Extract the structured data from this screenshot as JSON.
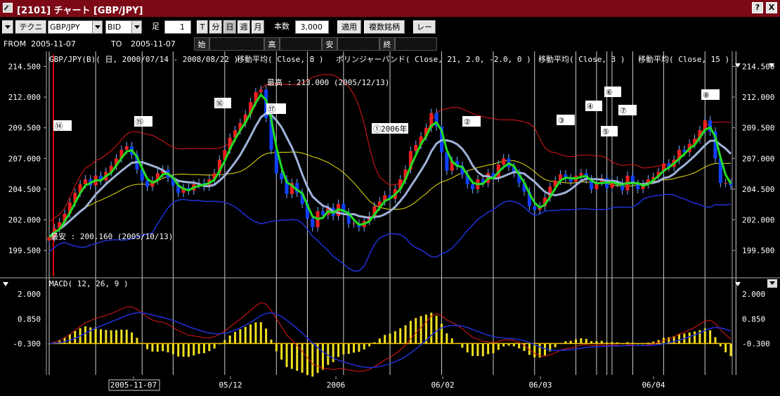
{
  "window": {
    "title": "[2101] チャート [GBP/JPY]",
    "btn_help": "?",
    "btn_close": "X"
  },
  "toolbar": {
    "technical": "テクニカル",
    "symbol": "GBP/JPY",
    "side": "BID",
    "ashi_label": "足",
    "ashi_value": "1",
    "t": "T",
    "fun": "分",
    "nichi": "日",
    "shu": "週",
    "tsuki": "月",
    "count_label": "本数",
    "count_value": "3,000",
    "apply": "適用",
    "multi": "複数銘柄",
    "rate": "レート"
  },
  "range": {
    "from_label": "FROM",
    "from_value": "2005-11-07",
    "to_label": "TO",
    "to_value": "2005-11-07",
    "open_label": "始",
    "high_label": "高",
    "low_label": "安",
    "close_label": "終"
  },
  "chart_data": {
    "type": "candlestick",
    "header": "GBP/JPY(B)( 日, 2000/07/14 - 2008/08/22 )",
    "indicator_labels": [
      "移動平均( Close, 8 )",
      "ボリンジャーバンド( Close, 21, 2.0, -2.0, 0 )",
      "移動平均( Close, 3 )",
      "移動平均( Close, 15 )"
    ],
    "y_ticks": [
      "214.500",
      "212.000",
      "209.500",
      "207.000",
      "204.500",
      "202.000",
      "199.500"
    ],
    "y_min": 197.5,
    "y_max": 215.5,
    "x_labels": [
      "2005-11-07",
      "05/12",
      "2006",
      "06/02",
      "06/03",
      "06/04"
    ],
    "annotation_high": "最高 : 213.000 (2005/12/13)",
    "annotation_low": "最安 : 200.160 (2005/10/13)",
    "markers": [
      "⑭",
      "⑮",
      "⑯",
      "⑰",
      "①2006年",
      "②",
      "③",
      "④",
      "⑤",
      "⑥",
      "⑦",
      "⑧"
    ],
    "close": [
      200.6,
      201.3,
      201.8,
      202.5,
      203.4,
      204.2,
      204.9,
      205.3,
      204.8,
      205.6,
      205.2,
      205.9,
      206.4,
      207.0,
      207.7,
      208.0,
      207.3,
      206.1,
      205.2,
      204.7,
      205.2,
      205.8,
      206.1,
      205.4,
      204.8,
      204.2,
      204.6,
      204.4,
      204.9,
      205.0,
      204.7,
      205.3,
      205.8,
      206.9,
      207.7,
      208.7,
      209.3,
      209.9,
      210.6,
      211.6,
      212.4,
      212.6,
      210.3,
      207.7,
      205.8,
      205.3,
      204.1,
      205.0,
      204.2,
      203.3,
      202.1,
      201.4,
      202.7,
      202.4,
      203.0,
      202.3,
      203.3,
      202.6,
      201.7,
      201.7,
      201.4,
      201.9,
      202.3,
      203.1,
      203.5,
      204.0,
      203.7,
      204.5,
      205.3,
      206.1,
      207.6,
      208.1,
      208.8,
      209.5,
      210.7,
      209.6,
      207.5,
      206.0,
      206.8,
      206.4,
      205.7,
      204.9,
      204.5,
      205.3,
      205.0,
      205.8,
      205.4,
      206.5,
      207.0,
      206.3,
      205.8,
      205.0,
      204.3,
      203.1,
      202.8,
      203.1,
      203.8,
      204.7,
      205.2,
      205.7,
      205.4,
      205.1,
      205.6,
      205.8,
      205.3,
      204.5,
      205.1,
      205.4,
      204.6,
      205.2,
      205.0,
      204.4,
      205.6,
      204.9,
      204.5,
      204.9,
      205.3,
      205.5,
      205.9,
      206.6,
      206.3,
      206.9,
      207.7,
      207.5,
      208.2,
      208.6,
      209.3,
      210.1,
      209.2,
      207.0,
      205.0,
      205.0,
      204.8
    ],
    "macd_y_ticks": [
      "2.000",
      "0.850",
      "-0.300"
    ],
    "macd_min": -1.6,
    "macd_max": 2.5,
    "macd_label": "MACD( 12, 26, 9 )"
  }
}
